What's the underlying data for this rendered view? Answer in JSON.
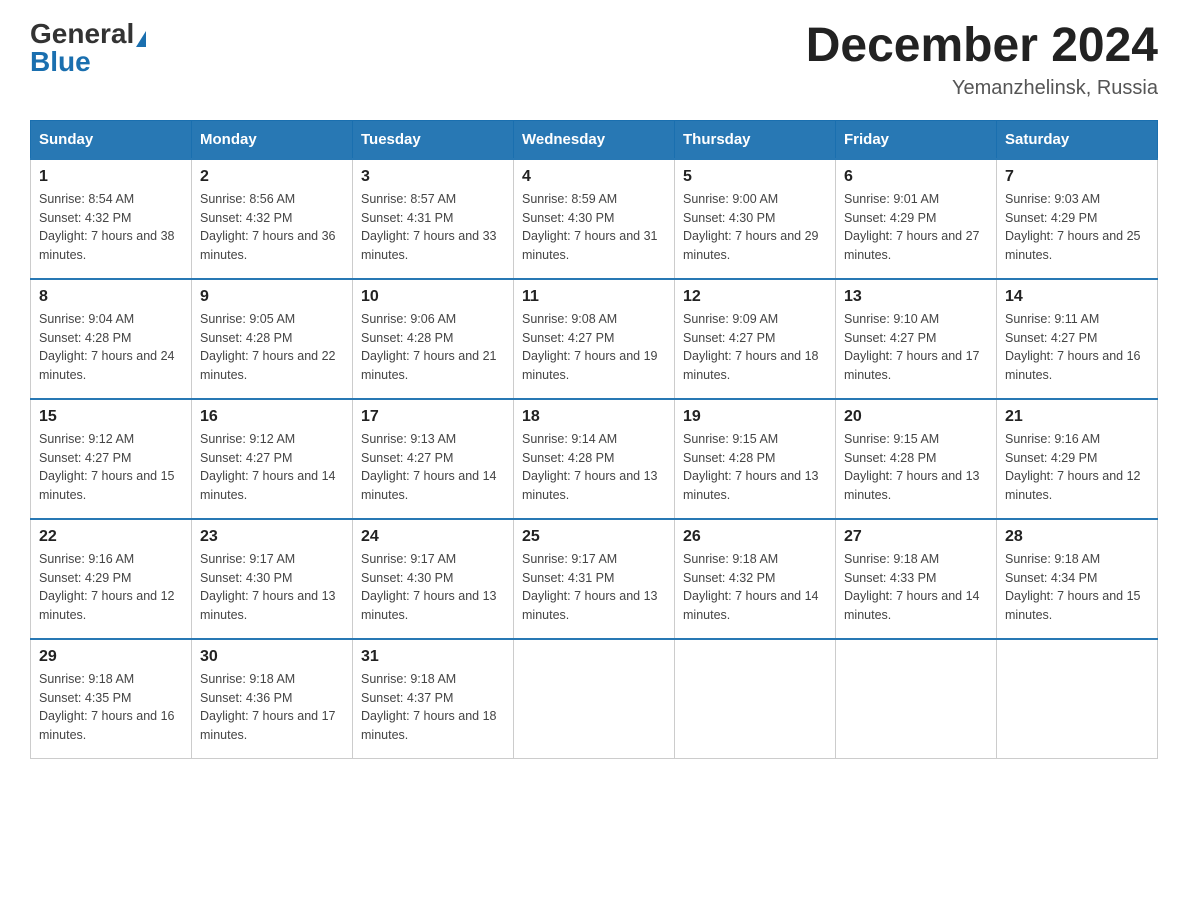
{
  "header": {
    "logo_general": "General",
    "logo_blue": "Blue",
    "month_title": "December 2024",
    "location": "Yemanzhelinsk, Russia"
  },
  "days_of_week": [
    "Sunday",
    "Monday",
    "Tuesday",
    "Wednesday",
    "Thursday",
    "Friday",
    "Saturday"
  ],
  "weeks": [
    [
      {
        "day": "1",
        "sunrise": "8:54 AM",
        "sunset": "4:32 PM",
        "daylight": "7 hours and 38 minutes."
      },
      {
        "day": "2",
        "sunrise": "8:56 AM",
        "sunset": "4:32 PM",
        "daylight": "7 hours and 36 minutes."
      },
      {
        "day": "3",
        "sunrise": "8:57 AM",
        "sunset": "4:31 PM",
        "daylight": "7 hours and 33 minutes."
      },
      {
        "day": "4",
        "sunrise": "8:59 AM",
        "sunset": "4:30 PM",
        "daylight": "7 hours and 31 minutes."
      },
      {
        "day": "5",
        "sunrise": "9:00 AM",
        "sunset": "4:30 PM",
        "daylight": "7 hours and 29 minutes."
      },
      {
        "day": "6",
        "sunrise": "9:01 AM",
        "sunset": "4:29 PM",
        "daylight": "7 hours and 27 minutes."
      },
      {
        "day": "7",
        "sunrise": "9:03 AM",
        "sunset": "4:29 PM",
        "daylight": "7 hours and 25 minutes."
      }
    ],
    [
      {
        "day": "8",
        "sunrise": "9:04 AM",
        "sunset": "4:28 PM",
        "daylight": "7 hours and 24 minutes."
      },
      {
        "day": "9",
        "sunrise": "9:05 AM",
        "sunset": "4:28 PM",
        "daylight": "7 hours and 22 minutes."
      },
      {
        "day": "10",
        "sunrise": "9:06 AM",
        "sunset": "4:28 PM",
        "daylight": "7 hours and 21 minutes."
      },
      {
        "day": "11",
        "sunrise": "9:08 AM",
        "sunset": "4:27 PM",
        "daylight": "7 hours and 19 minutes."
      },
      {
        "day": "12",
        "sunrise": "9:09 AM",
        "sunset": "4:27 PM",
        "daylight": "7 hours and 18 minutes."
      },
      {
        "day": "13",
        "sunrise": "9:10 AM",
        "sunset": "4:27 PM",
        "daylight": "7 hours and 17 minutes."
      },
      {
        "day": "14",
        "sunrise": "9:11 AM",
        "sunset": "4:27 PM",
        "daylight": "7 hours and 16 minutes."
      }
    ],
    [
      {
        "day": "15",
        "sunrise": "9:12 AM",
        "sunset": "4:27 PM",
        "daylight": "7 hours and 15 minutes."
      },
      {
        "day": "16",
        "sunrise": "9:12 AM",
        "sunset": "4:27 PM",
        "daylight": "7 hours and 14 minutes."
      },
      {
        "day": "17",
        "sunrise": "9:13 AM",
        "sunset": "4:27 PM",
        "daylight": "7 hours and 14 minutes."
      },
      {
        "day": "18",
        "sunrise": "9:14 AM",
        "sunset": "4:28 PM",
        "daylight": "7 hours and 13 minutes."
      },
      {
        "day": "19",
        "sunrise": "9:15 AM",
        "sunset": "4:28 PM",
        "daylight": "7 hours and 13 minutes."
      },
      {
        "day": "20",
        "sunrise": "9:15 AM",
        "sunset": "4:28 PM",
        "daylight": "7 hours and 13 minutes."
      },
      {
        "day": "21",
        "sunrise": "9:16 AM",
        "sunset": "4:29 PM",
        "daylight": "7 hours and 12 minutes."
      }
    ],
    [
      {
        "day": "22",
        "sunrise": "9:16 AM",
        "sunset": "4:29 PM",
        "daylight": "7 hours and 12 minutes."
      },
      {
        "day": "23",
        "sunrise": "9:17 AM",
        "sunset": "4:30 PM",
        "daylight": "7 hours and 13 minutes."
      },
      {
        "day": "24",
        "sunrise": "9:17 AM",
        "sunset": "4:30 PM",
        "daylight": "7 hours and 13 minutes."
      },
      {
        "day": "25",
        "sunrise": "9:17 AM",
        "sunset": "4:31 PM",
        "daylight": "7 hours and 13 minutes."
      },
      {
        "day": "26",
        "sunrise": "9:18 AM",
        "sunset": "4:32 PM",
        "daylight": "7 hours and 14 minutes."
      },
      {
        "day": "27",
        "sunrise": "9:18 AM",
        "sunset": "4:33 PM",
        "daylight": "7 hours and 14 minutes."
      },
      {
        "day": "28",
        "sunrise": "9:18 AM",
        "sunset": "4:34 PM",
        "daylight": "7 hours and 15 minutes."
      }
    ],
    [
      {
        "day": "29",
        "sunrise": "9:18 AM",
        "sunset": "4:35 PM",
        "daylight": "7 hours and 16 minutes."
      },
      {
        "day": "30",
        "sunrise": "9:18 AM",
        "sunset": "4:36 PM",
        "daylight": "7 hours and 17 minutes."
      },
      {
        "day": "31",
        "sunrise": "9:18 AM",
        "sunset": "4:37 PM",
        "daylight": "7 hours and 18 minutes."
      },
      null,
      null,
      null,
      null
    ]
  ]
}
